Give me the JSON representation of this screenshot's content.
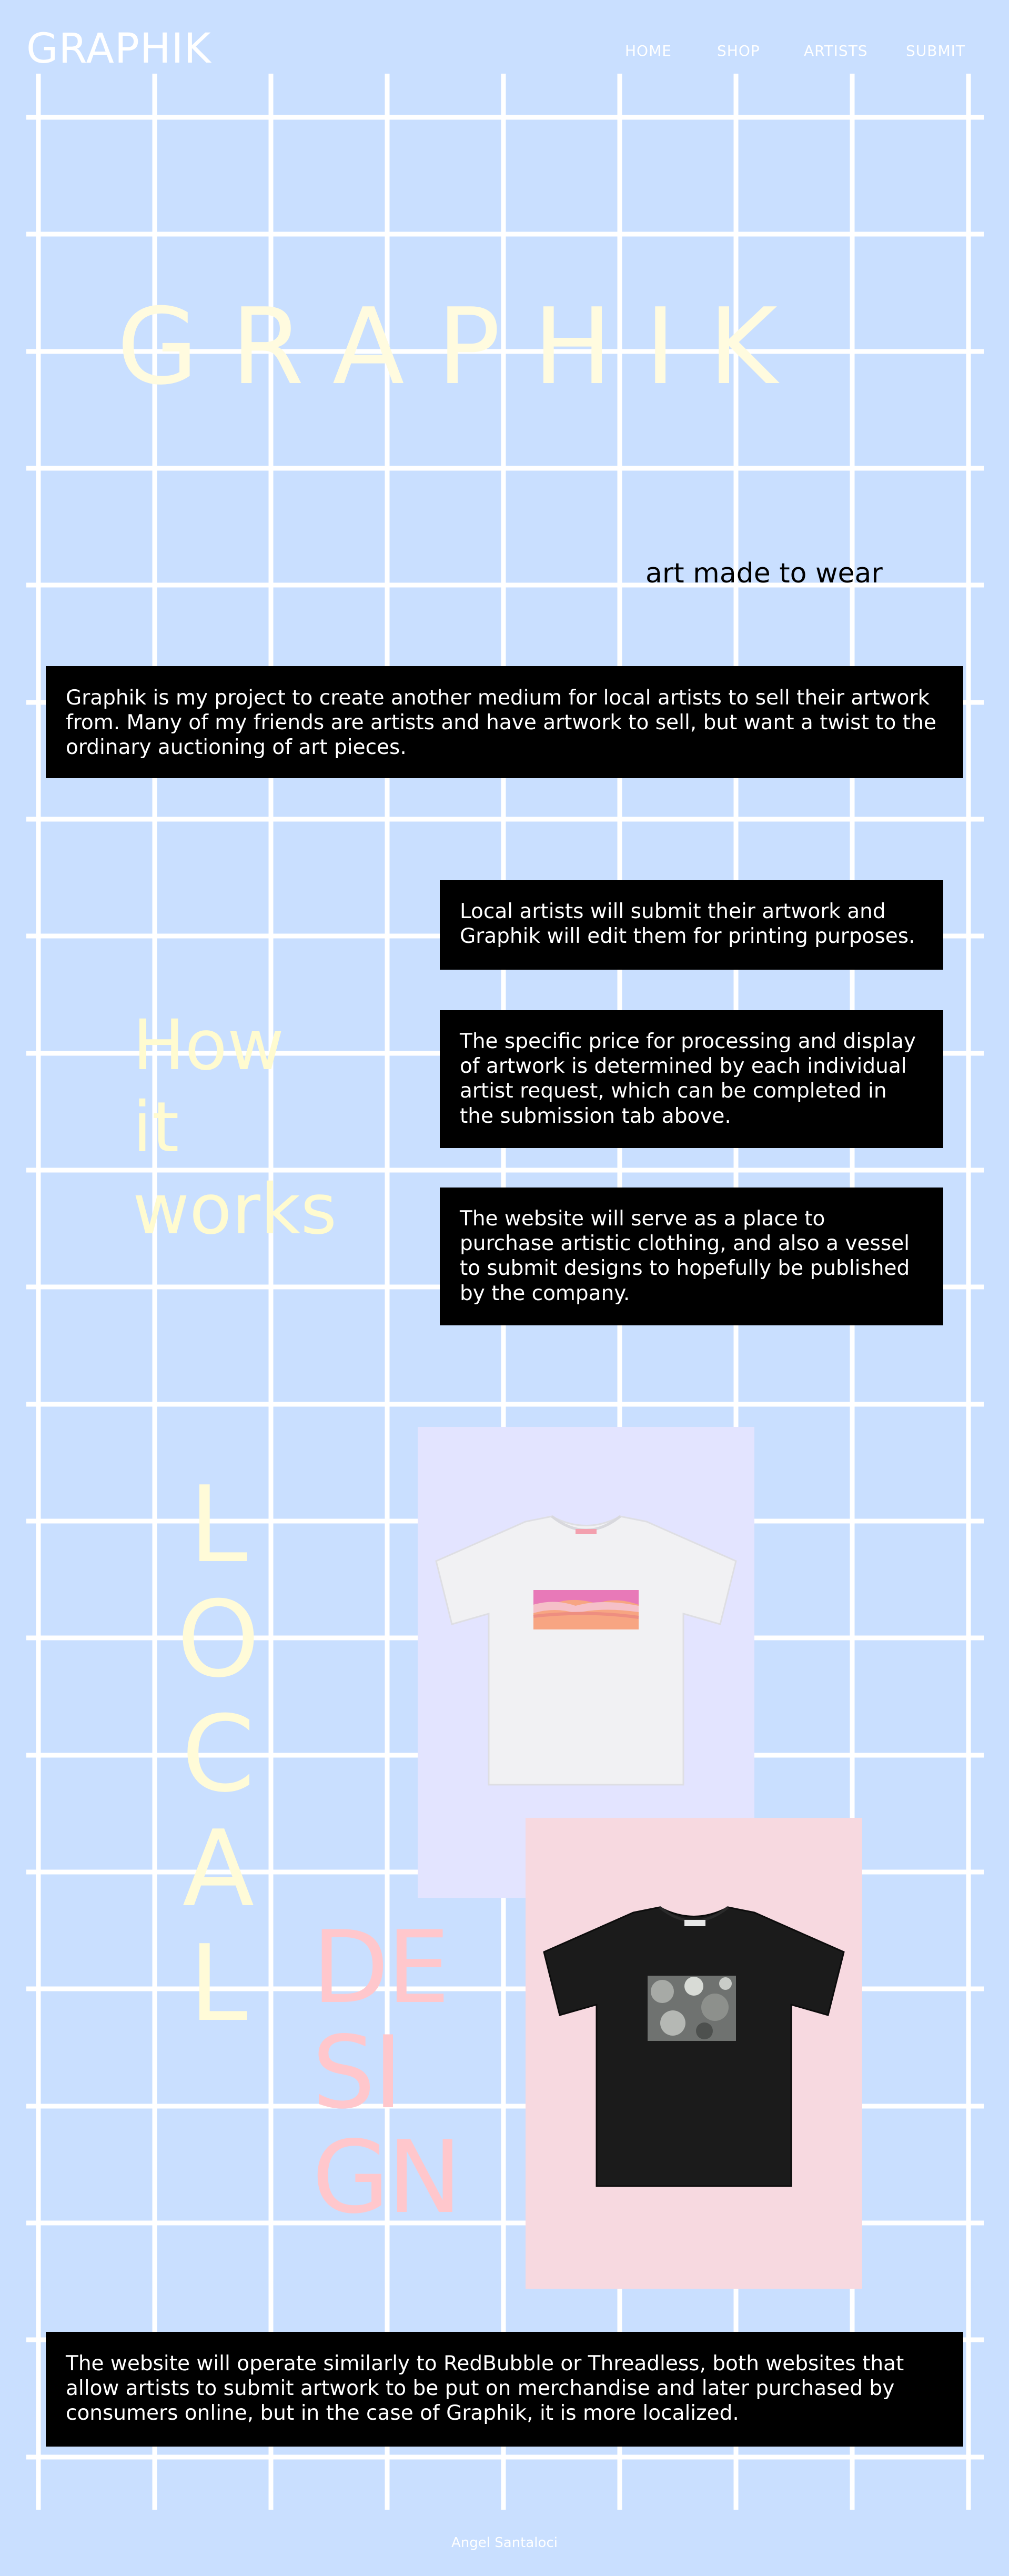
{
  "header": {
    "logo": "GRAPHIK",
    "nav": [
      "HOME",
      "SHOP",
      "ARTISTS",
      "SUBMIT"
    ]
  },
  "hero": {
    "title": "GRAPHIK",
    "tagline": "art made to wear"
  },
  "intro": {
    "text": "Graphik is my project to create another medium for local artists to sell their artwork from. Many of my friends are artists and have artwork to sell, but want a twist to the ordinary auctioning of art pieces."
  },
  "how_it_works": {
    "heading_lines": [
      "How",
      "it",
      "works"
    ],
    "steps": [
      "Local artists will submit their artwork and Graphik will edit them for printing purposes.",
      "The specific price for processing and display of artwork is determined by each individual artist request, which can be completed in the submission tab above.",
      "The website will serve as a place to purchase artistic clothing, and also a vessel to submit designs to hopefully be published by the company."
    ]
  },
  "showcase": {
    "local_letters": [
      "L",
      "O",
      "C",
      "A",
      "L"
    ],
    "design_lines": [
      "DE",
      "SI",
      "GN"
    ]
  },
  "outro": {
    "text": "The website will operate similarly to RedBubble or Threadless, both websites that allow artists to submit artwork to be put on merchandise and later purchased by consumers online, but in the case of Graphik, it is more localized."
  },
  "footer": {
    "credit": "Angel Santaloci"
  },
  "colors": {
    "background": "#c9dfff",
    "grid": "#ffffff",
    "cream": "#fffbdf",
    "pink": "#ffc7cc",
    "card_lavender": "#e3e4ff",
    "card_pink": "#f7d9e0"
  }
}
